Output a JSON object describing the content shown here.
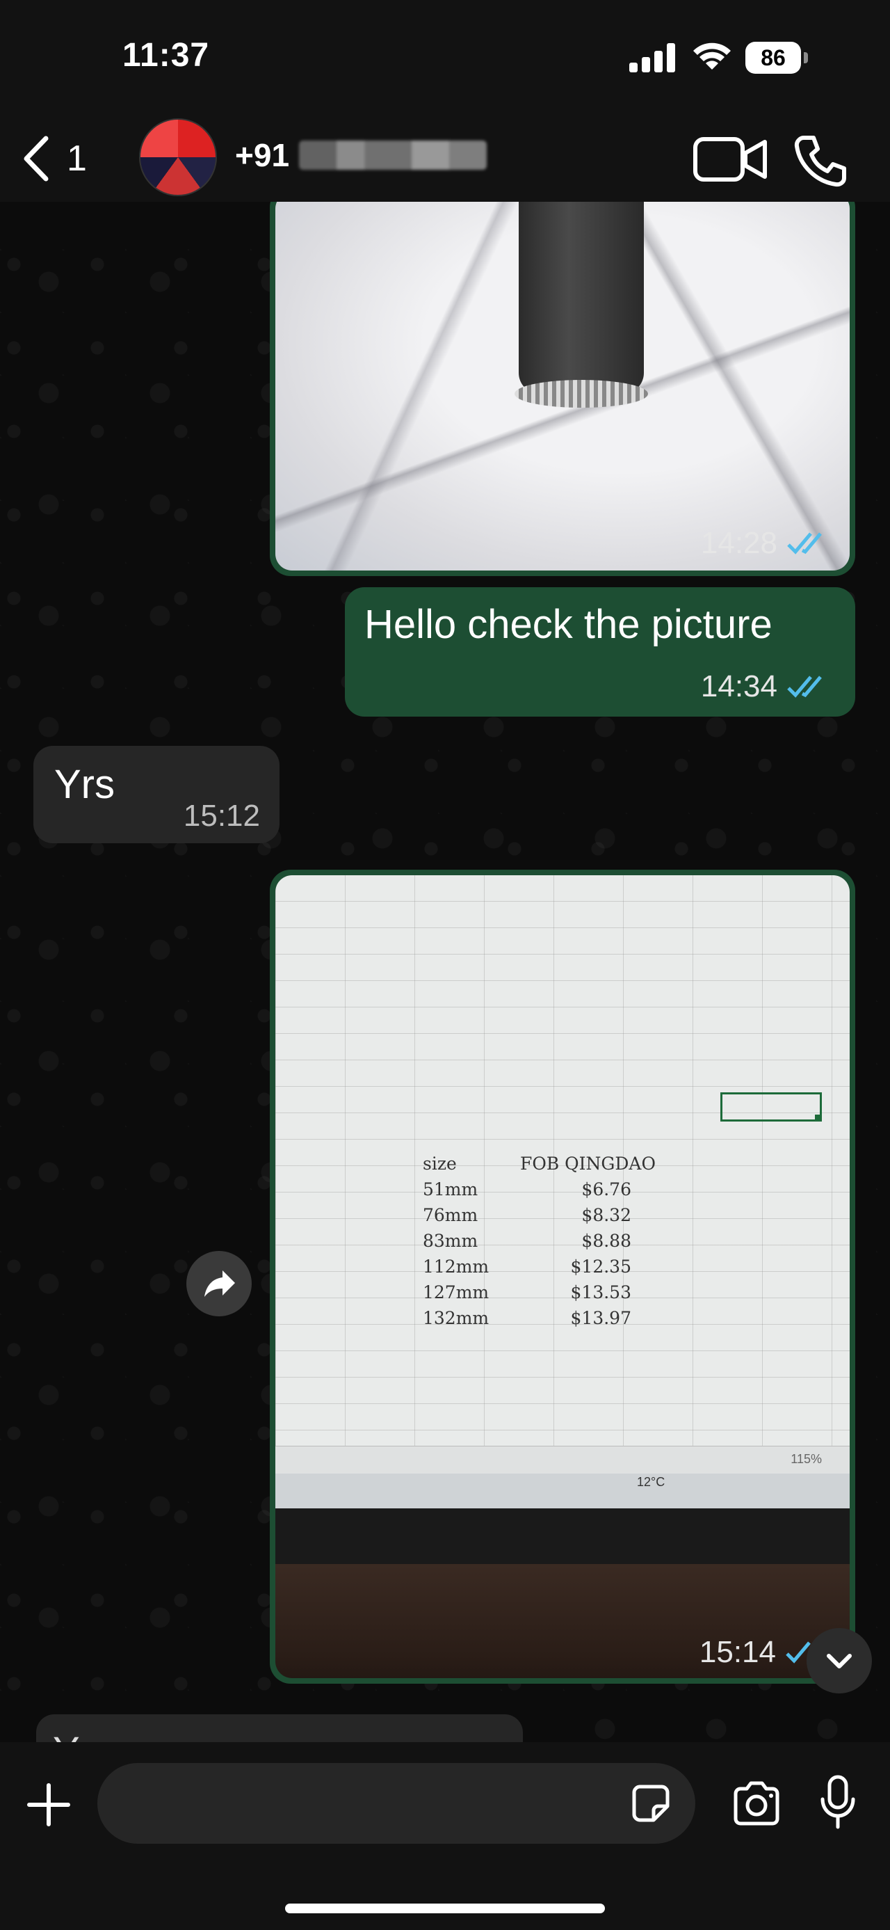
{
  "status_bar": {
    "time": "11:37",
    "battery": "86"
  },
  "header": {
    "back_count": "1",
    "contact_prefix": "+91"
  },
  "messages": [
    {
      "type": "image",
      "direction": "outgoing",
      "time": "14:28",
      "status": "read"
    },
    {
      "type": "text",
      "direction": "outgoing",
      "text": "Hello check the picture",
      "time": "14:34",
      "status": "read"
    },
    {
      "type": "text",
      "direction": "incoming",
      "text": "Yrs",
      "time": "15:12"
    },
    {
      "type": "image",
      "direction": "outgoing",
      "time": "15:14",
      "status": "sent",
      "photo_content": {
        "headers": [
          "size",
          "FOB QINGDAO"
        ],
        "rows": [
          [
            "51mm",
            "$6.76"
          ],
          [
            "76mm",
            "$8.32"
          ],
          [
            "83mm",
            "$8.88"
          ],
          [
            "112mm",
            "$12.35"
          ],
          [
            "127mm",
            "$13.53"
          ],
          [
            "132mm",
            "$13.97"
          ]
        ],
        "zoom": "115%",
        "temperature": "12°C"
      }
    },
    {
      "type": "text",
      "direction": "incoming",
      "text": "Y",
      "partial": true
    }
  ],
  "colors": {
    "outgoing_bubble": "#1d4e33",
    "incoming_bubble": "#262626",
    "read_tick": "#53bdeb"
  },
  "icons": [
    "back-chevron-icon",
    "video-call-icon",
    "phone-icon",
    "forward-icon",
    "chevron-down-icon",
    "plus-icon",
    "sticker-icon",
    "camera-icon",
    "microphone-icon"
  ]
}
